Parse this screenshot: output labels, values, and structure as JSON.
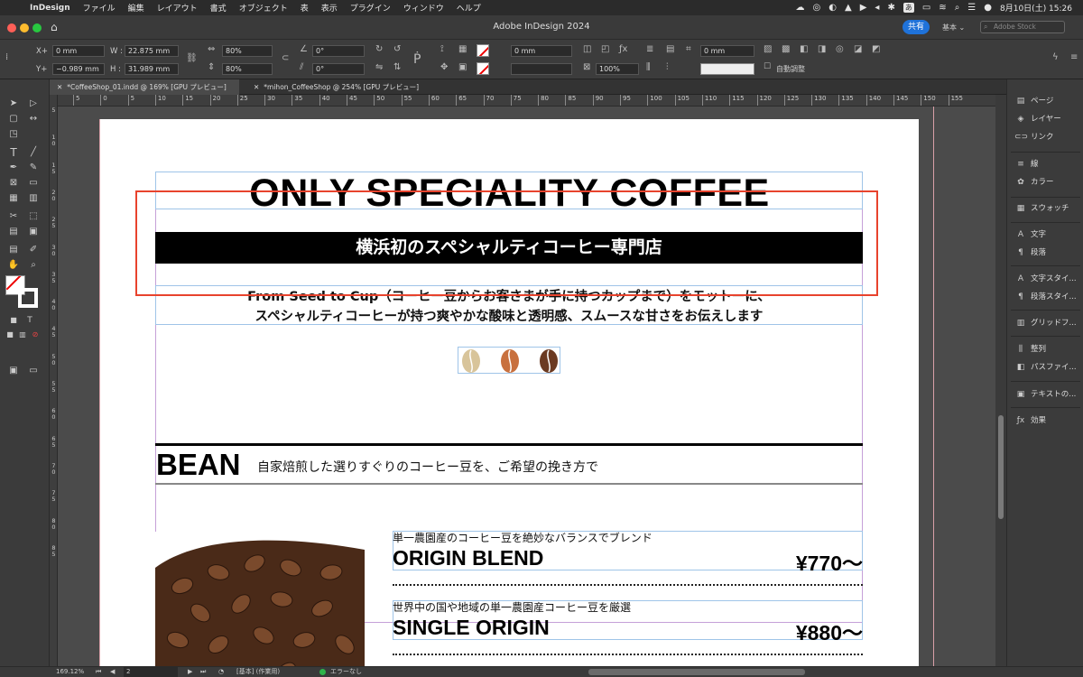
{
  "menubar": {
    "app": "InDesign",
    "items": [
      "ファイル",
      "編集",
      "レイアウト",
      "書式",
      "オブジェクト",
      "表",
      "表示",
      "プラグイン",
      "ウィンドウ",
      "ヘルプ"
    ],
    "input_mode": "あ",
    "datetime": "8月10日(土)  15:26"
  },
  "window": {
    "title": "Adobe InDesign 2024",
    "share_label": "共有",
    "workspace_label": "基本 ⌄",
    "stock_placeholder": "Adobe Stock"
  },
  "control_panel": {
    "x_label": "X+",
    "x_value": "0 mm",
    "y_label": "Y+",
    "y_value": "−0.989 mm",
    "w_label": "W :",
    "w_value": "22.875 mm",
    "h_label": "H :",
    "h_value": "31.989 mm",
    "scale_x": "80%",
    "scale_y": "80%",
    "rotate": "0°",
    "shear": "0°",
    "stroke_weight": "0 mm",
    "stroke_weight_2": "0 mm",
    "opacity": "100%",
    "auto_fit_label": "自動調整"
  },
  "tabs": [
    {
      "label": "*CoffeeShop_01.indd @ 169% [GPU プレビュー]",
      "active": true
    },
    {
      "label": "*mihon_CoffeeShop @ 254% [GPU プレビュー]",
      "active": false
    }
  ],
  "ruler": {
    "h_ticks": [
      "5",
      "0",
      "5",
      "10",
      "15",
      "20",
      "25",
      "30",
      "35",
      "40",
      "45",
      "50",
      "55",
      "60",
      "65",
      "70",
      "75",
      "80",
      "85",
      "90",
      "95",
      "100",
      "105",
      "110",
      "115",
      "120",
      "125",
      "130",
      "135",
      "140",
      "145",
      "150",
      "155"
    ],
    "v_ticks": [
      "5",
      "1\n0",
      "1\n5",
      "2\n0",
      "2\n5",
      "3\n0",
      "3\n5",
      "4\n0",
      "4\n5",
      "5\n0",
      "5\n5",
      "6\n0",
      "6\n5",
      "7\n0",
      "7\n5",
      "8\n0",
      "8\n5"
    ]
  },
  "document": {
    "headline": "ONLY SPECIALITY COFFEE",
    "subheadline": "横浜初のスペシャルティコーヒー専門店",
    "lead_line1": "From Seed to Cup（コーヒー豆からお客さまが手に持つカップまで）をモットーに、",
    "lead_line2": "スペシャルティコーヒーが持つ爽やかな酸味と透明感、スムースな甘さをお伝えします",
    "bean_colors": [
      "#d8c49a",
      "#c8703e",
      "#6b3a22"
    ],
    "section_title": "BEAN",
    "section_subtitle": "自家焙煎した選りすぐりのコーヒー豆を、ご希望の挽き方で",
    "menu": [
      {
        "desc": "単一農園産のコーヒー豆を絶妙なバランスでブレンド",
        "name": "ORIGIN BLEND",
        "price": "¥770〜"
      },
      {
        "desc": "世界中の国や地域の単一農園産コーヒー豆を厳選",
        "name": "SINGLE ORIGIN",
        "price": "¥880〜"
      }
    ]
  },
  "right_panel": {
    "items": [
      "ページ",
      "レイヤー",
      "リンク",
      "線",
      "カラー",
      "スウォッチ",
      "文字",
      "段落",
      "文字スタイ...",
      "段落スタイ...",
      "グリッドフ...",
      "整列",
      "パスファイ...",
      "テキストの...",
      "効果"
    ]
  },
  "status": {
    "zoom": "169.12%",
    "page": "2",
    "style": "[基本] (作業用)",
    "errors": "エラーなし"
  },
  "colors": {
    "accent": "#1f72d9",
    "selection_box": "#e8432d",
    "ok": "#2fb34a"
  }
}
